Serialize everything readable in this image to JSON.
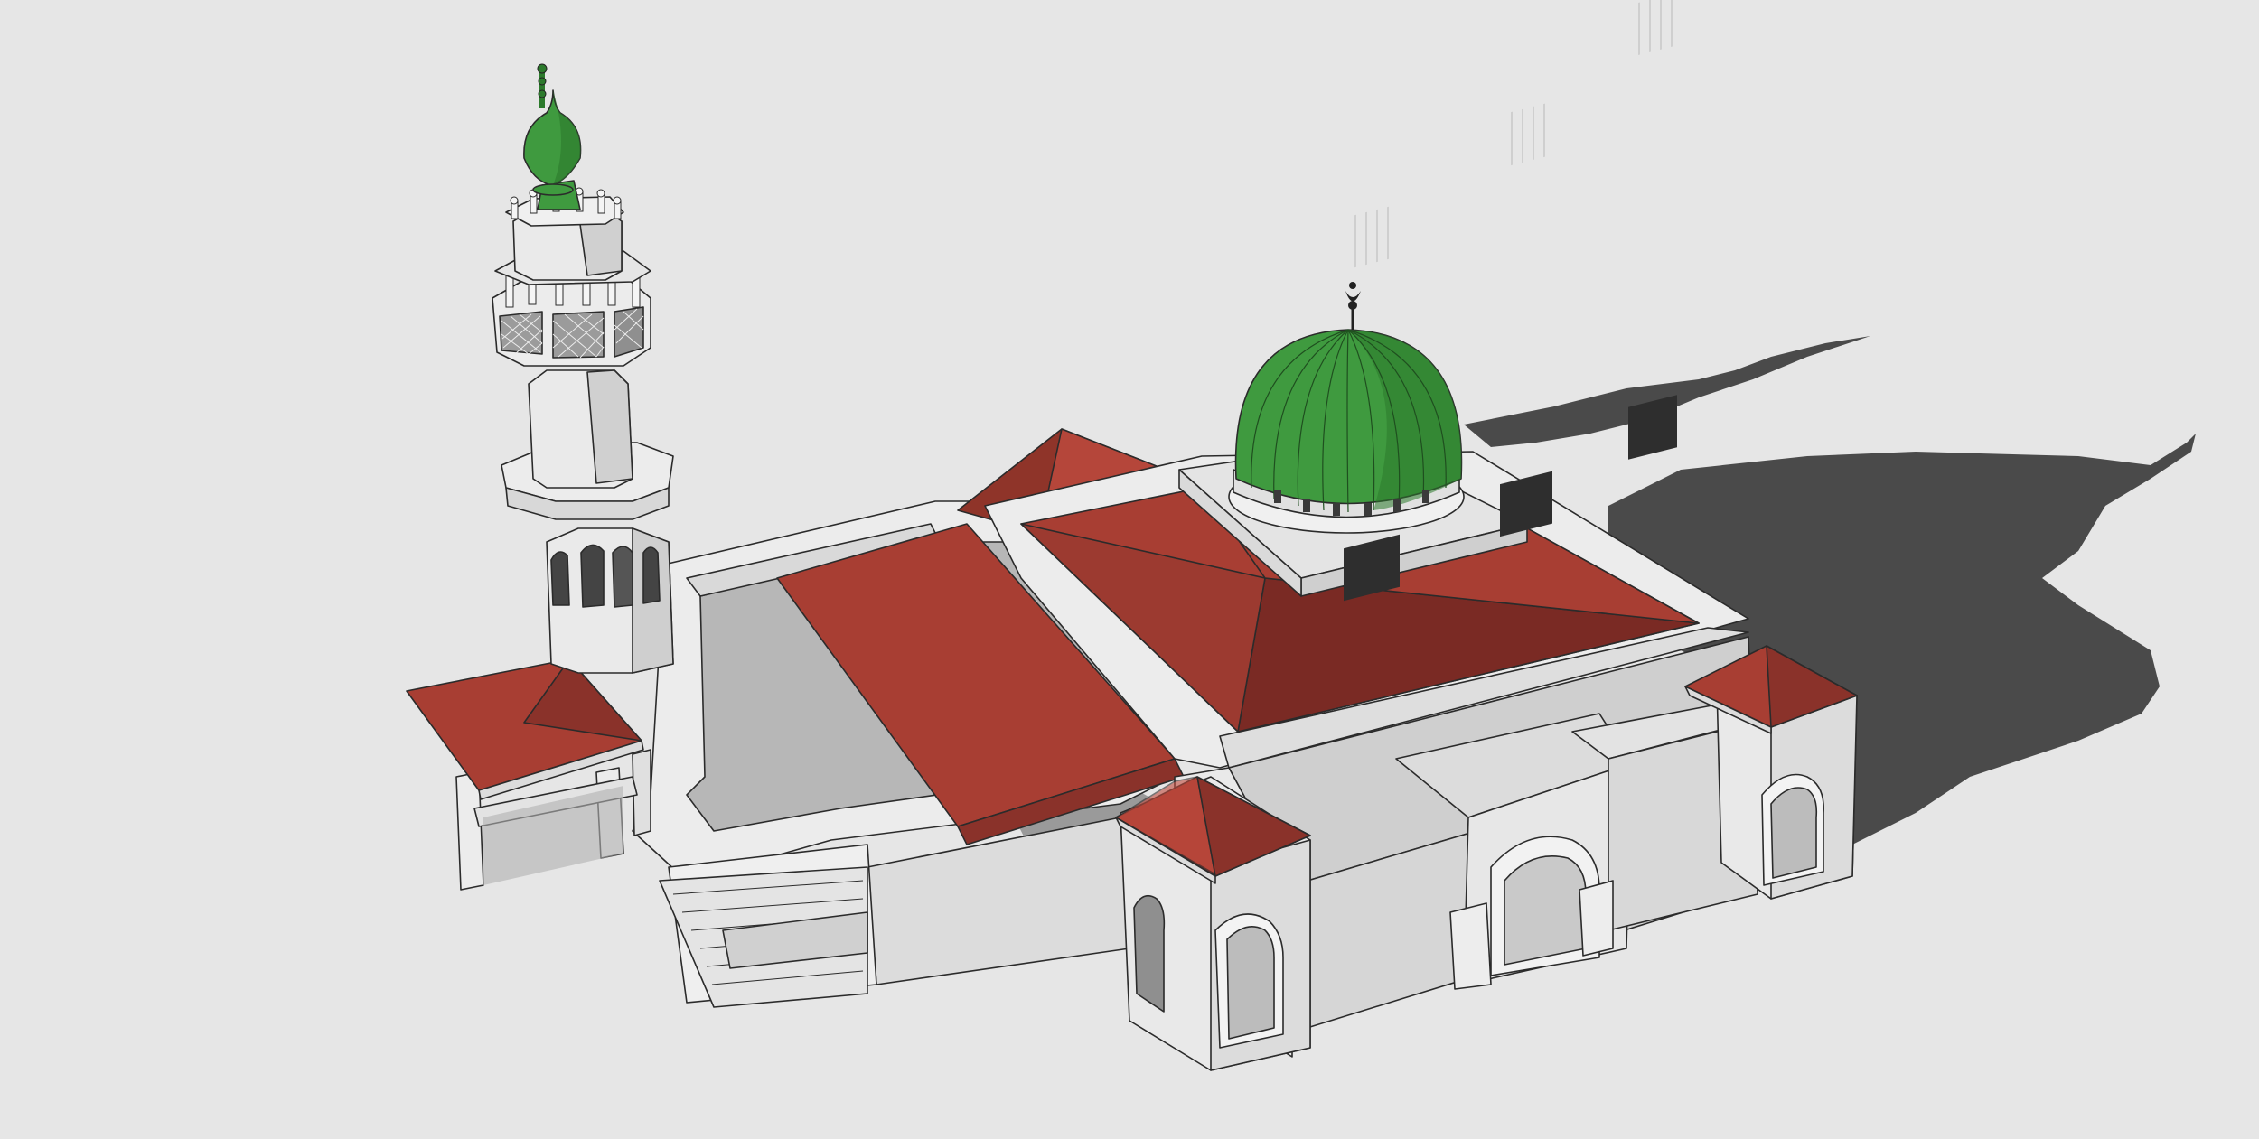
{
  "scene": {
    "subject": "mosque-3d-model",
    "background_color": "#e6e6e6",
    "shadow_color": "#4a4a4a",
    "wall_color": "#ececec",
    "wall_shade_color": "#bdbdbd",
    "roof_color": "#a83e33",
    "roof_dark_color": "#7a2a24",
    "dome_color": "#3f9a3f",
    "dome_dark_color": "#2c7a2c",
    "window_color": "#3a3a3a",
    "icons": [
      "crescent-finial-icon",
      "minaret-finial-icon"
    ]
  }
}
